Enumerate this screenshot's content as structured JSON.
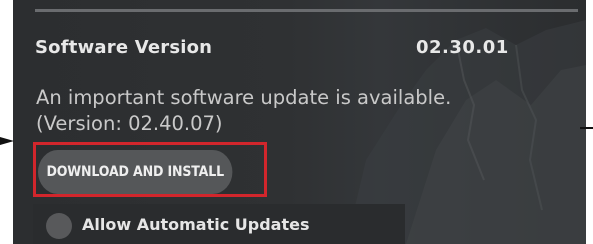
{
  "software": {
    "label": "Software Version",
    "version": "02.30.01"
  },
  "update_message": {
    "line1": "An important software update is available.",
    "line2": "(Version: 02.40.07)"
  },
  "actions": {
    "download_label": "DOWNLOAD AND INSTALL"
  },
  "auto_updates": {
    "label": "Allow Automatic Updates",
    "enabled": false
  },
  "annotation": {
    "highlight_color": "#d2262c"
  },
  "colors": {
    "panel_bg": "#2f3133",
    "button_bg": "#555759",
    "text_primary": "#e8e8e8",
    "text_secondary": "#c9c9c9"
  }
}
